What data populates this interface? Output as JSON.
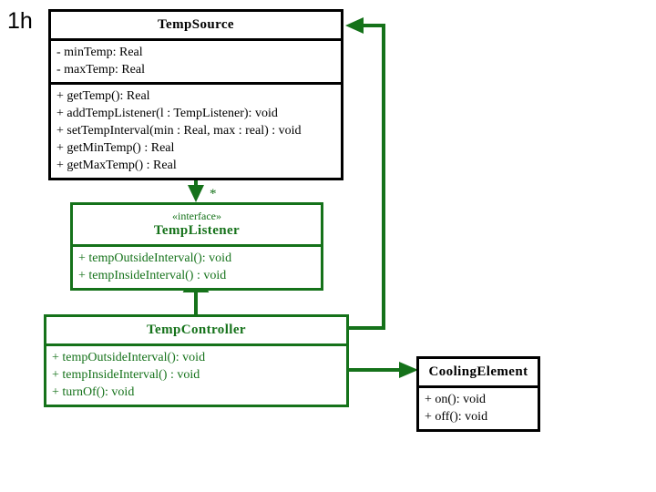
{
  "slide": {
    "label": "1h",
    "background_color": "#ffffff"
  },
  "colors": {
    "green": "#15721a",
    "black": "#000000",
    "white": "#ffffff"
  },
  "classes": {
    "temp_source": {
      "name": "TempSource",
      "stereotype": "",
      "attributes": [
        "- minTemp: Real",
        "- maxTemp: Real"
      ],
      "operations": [
        "+ getTemp(): Real",
        "+ addTempListener(l : TempListener): void",
        "+ setTempInterval(min : Real, max : real) : void",
        "+ getMinTemp() : Real",
        "+ getMaxTemp() : Real"
      ]
    },
    "temp_listener": {
      "name": "TempListener",
      "stereotype": "«interface»",
      "attributes": [],
      "operations": [
        "+ tempOutsideInterval(): void",
        "+ tempInsideInterval() : void"
      ]
    },
    "temp_controller": {
      "name": "TempController",
      "stereotype": "",
      "attributes": [],
      "operations": [
        "+ tempOutsideInterval(): void",
        "+ tempInsideInterval() : void",
        "+ turnOf(): void"
      ]
    },
    "cooling_element": {
      "name": "CoolingElement",
      "stereotype": "",
      "attributes": [],
      "operations": [
        "+ on(): void",
        "+ off(): void"
      ]
    }
  },
  "relationships": {
    "source_to_listener": {
      "multiplicity": "*",
      "kind": "association-arrow"
    },
    "listener_to_controller": {
      "kind": "realization-triangle"
    },
    "controller_to_source": {
      "kind": "association-arrow"
    },
    "controller_to_cooling": {
      "kind": "association-arrow"
    }
  }
}
